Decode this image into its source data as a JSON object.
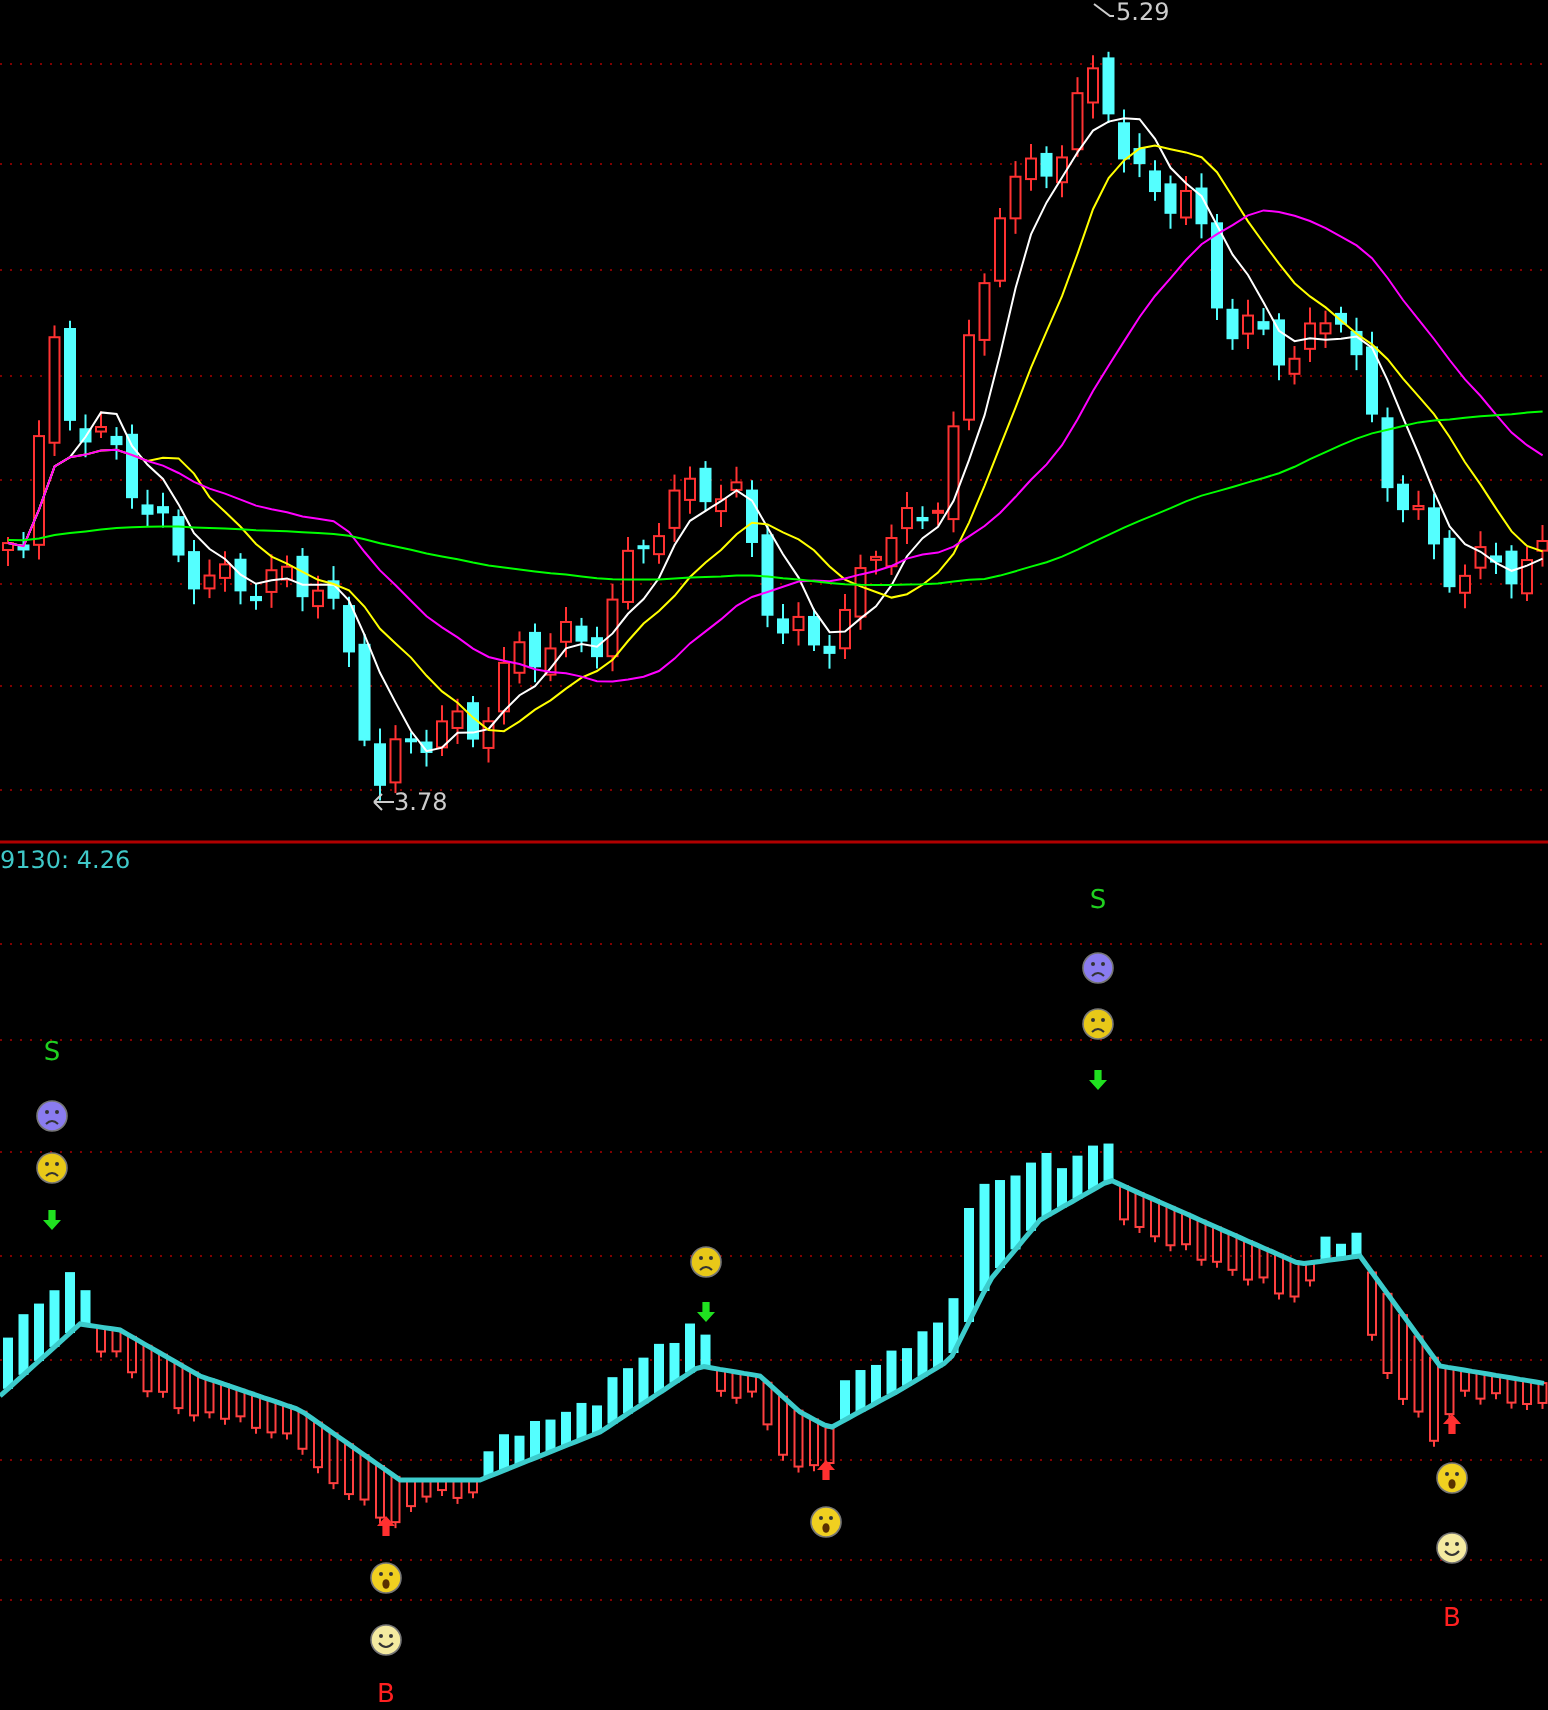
{
  "upper_chart": {
    "high_label": "5.29",
    "low_label": "3.78"
  },
  "lower_chart": {
    "indicator_label": "9130: 4.26",
    "signals": [
      {
        "marks": [
          {
            "kind": "sell-letter",
            "text": "S"
          },
          {
            "kind": "frown-purple"
          },
          {
            "kind": "frown-yellow"
          },
          {
            "kind": "arrow-down"
          }
        ]
      },
      {
        "marks": [
          {
            "kind": "arrow-up"
          },
          {
            "kind": "shocked-yellow"
          },
          {
            "kind": "smile"
          },
          {
            "kind": "buy-letter",
            "text": "B"
          }
        ]
      },
      {
        "marks": [
          {
            "kind": "frown-yellow"
          },
          {
            "kind": "arrow-down"
          }
        ]
      },
      {
        "marks": [
          {
            "kind": "arrow-up"
          },
          {
            "kind": "shocked-yellow"
          }
        ]
      },
      {
        "marks": [
          {
            "kind": "sell-letter",
            "text": "S"
          },
          {
            "kind": "frown-purple"
          },
          {
            "kind": "frown-yellow"
          },
          {
            "kind": "arrow-down"
          }
        ]
      },
      {
        "marks": [
          {
            "kind": "arrow-up"
          },
          {
            "kind": "shocked-yellow"
          },
          {
            "kind": "smile"
          },
          {
            "kind": "buy-letter",
            "text": "B"
          }
        ]
      }
    ]
  }
}
